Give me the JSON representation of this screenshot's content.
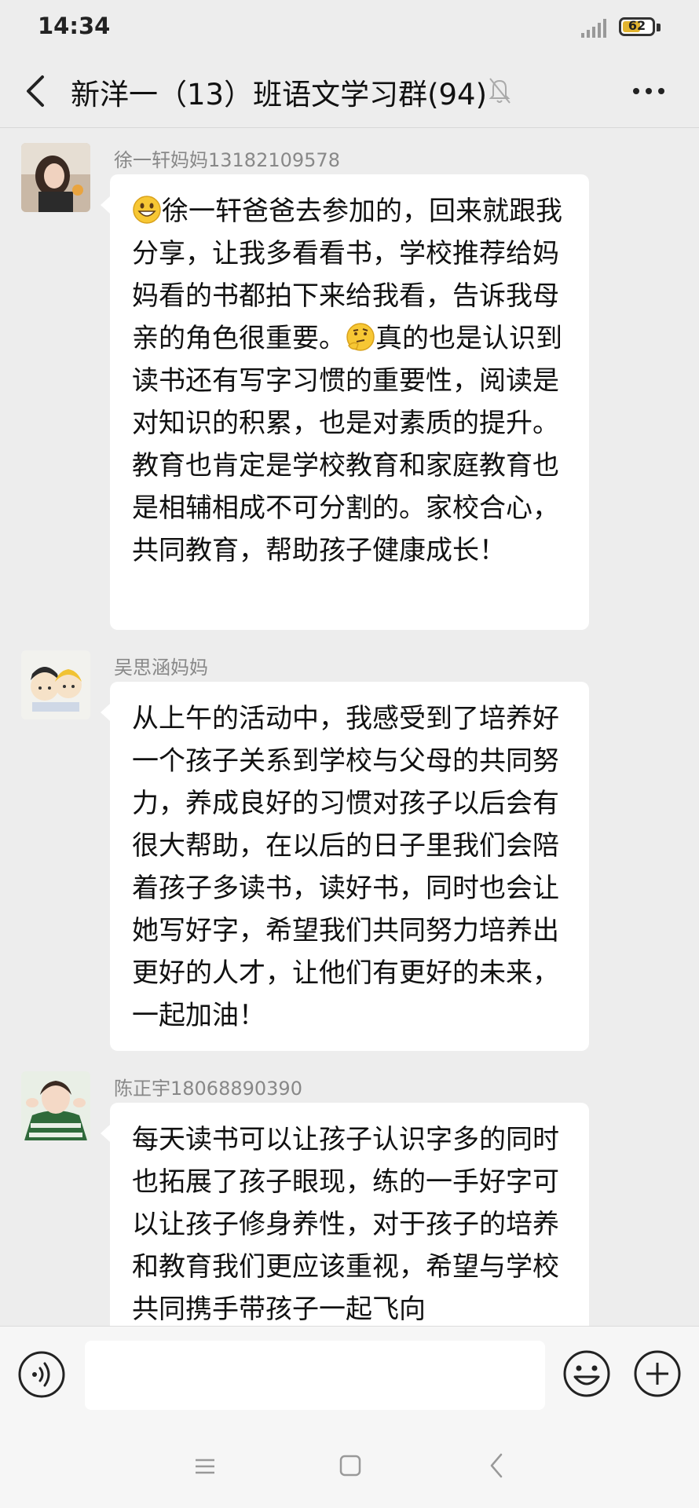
{
  "status_bar": {
    "time": "14:34",
    "battery": "62",
    "battery_level": 0.62
  },
  "header": {
    "title": "新洋一（13）班语文学习群(94)"
  },
  "messages": [
    {
      "sender": "徐一轩妈妈13182109578",
      "lead_icon": "grinning-emoji",
      "text_1": "徐一轩爸爸去参加的，回来就跟我分享，让我多看看书，学校推荐给妈妈看的书都拍下来给我看，告诉我母亲的角色很重要。",
      "mid_icon": "thinking-emoji",
      "text_2": "真的也是认识到读书还有写字习惯的重要性，阅读是对知识的积累，也是对素质的提升。教育也肯定是学校教育和家庭教育也是相辅相成不可分割的。家校合心，共同教育，帮助孩子健康成长！"
    },
    {
      "sender": "吴思涵妈妈",
      "text": "从上午的活动中，我感受到了培养好一个孩子关系到学校与父母的共同努力，养成良好的习惯对孩子以后会有很大帮助，在以后的日子里我们会陪着孩子多读书，读好书，同时也会让她写好字，希望我们共同努力培养出更好的人才，让他们有更好的未来，一起加油！"
    },
    {
      "sender": "陈正宇18068890390",
      "text": "每天读书可以让孩子认识字多的同时也拓展了孩子眼现，练的一手好字可以让孩子修身养性，对于孩子的培养和教育我们更应该重视，希望与学校共同携手带孩子一起飞向"
    }
  ],
  "input_bar": {
    "placeholder": ""
  },
  "icons": {
    "back": "back-arrow-icon",
    "mute": "muted-bell-icon",
    "more": "more-dots-icon",
    "voice": "voice-icon",
    "emoji": "emoji-icon",
    "add": "add-icon"
  },
  "colors": {
    "background": "#ededed",
    "bubble": "#ffffff",
    "sender_name": "#888888",
    "battery": "#e2b42f"
  }
}
